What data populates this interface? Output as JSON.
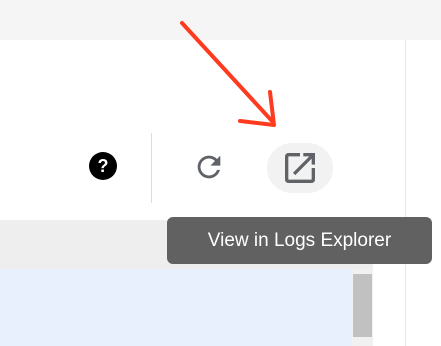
{
  "toolbar": {
    "help_icon": "help-circle-icon",
    "refresh_icon": "refresh-icon",
    "open_in_new_icon": "open-in-new-icon"
  },
  "tooltip": {
    "text": "View in Logs Explorer"
  },
  "colors": {
    "annotation_arrow": "#ff3b1f",
    "tooltip_background": "#616161",
    "selected_row": "#e8f0fe",
    "icon_color": "#000000",
    "refresh_icon_color": "#5f6368"
  }
}
